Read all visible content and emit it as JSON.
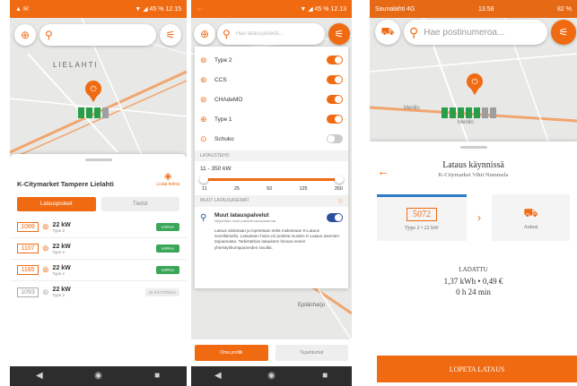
{
  "screen1": {
    "status_time": "12.15",
    "status_battery": "45 %",
    "map_label": "LIELAHTI",
    "station_name": "K-Citymarket Tampere Lielahti",
    "more_info_label": "Lisää tietoa",
    "tabs": [
      "Latauspisteet",
      "Tiedot"
    ],
    "chargers": [
      {
        "id": "1089",
        "power": "22 kW",
        "type": "Type 2",
        "status": "VAPAA"
      },
      {
        "id": "1107",
        "power": "22 kW",
        "type": "Type 2",
        "status": "VAPAA"
      },
      {
        "id": "1185",
        "power": "22 kW",
        "type": "Type 2",
        "status": "VAPAA"
      },
      {
        "id": "1093",
        "power": "22 kW",
        "type": "Type 2",
        "status": "EI KÄYTÖSSÄ"
      }
    ]
  },
  "screen2": {
    "status_time": "12.13",
    "status_battery": "45 %",
    "search_placeholder": "Hae latauspisteitä...",
    "connectors": [
      {
        "label": "Type 2",
        "on": true
      },
      {
        "label": "CCS",
        "on": true
      },
      {
        "label": "CHAdeMO",
        "on": true
      },
      {
        "label": "Type 1",
        "on": true
      },
      {
        "label": "Schuko",
        "on": false
      }
    ],
    "power_section_title": "LATAUSTEHO",
    "power_range": "11 - 350 kW",
    "power_ticks": [
      "11",
      "25",
      "50",
      "125",
      "350"
    ],
    "other_section_title": "MUUT LATAUSASEMAT",
    "other_services_title": "Muut latauspalvelut",
    "other_services_sub": "Näytetään muut palvelut latausasemat",
    "info_text": "Lataus aloitetaan ja lopetetaan sekä maksetaan K-Lataus sovelluksella. Latauksen hinta voi poiketa muiden K-Lataus asemien tarjoamasta. Tarkistathan latauksen hinnan ennen yhteistyökumppaneiden sivuilta.",
    "map_label": "Epilänharju",
    "bottom_tabs": [
      "Oma profiili",
      "Tapahtumat"
    ]
  },
  "screen3": {
    "status_carrier": "Saunalahti  4G",
    "status_time": "13.58",
    "status_battery": "82 %",
    "search_placeholder": "Hae postinumeroa...",
    "map_labels": [
      "Merilin",
      "Merilin"
    ],
    "title": "Lataus käynnissä",
    "subtitle": "K-Citymarket Vihti Nummela",
    "charger_id": "5072",
    "charger_desc": "Type 2 • 22 kW",
    "car_label": "Autosi",
    "charged_label": "LADATTU",
    "charged_value": "1,37 kWh  •  0,49 €",
    "duration": "0 h 24 min",
    "stop_button": "LOPETA LATAUS"
  }
}
